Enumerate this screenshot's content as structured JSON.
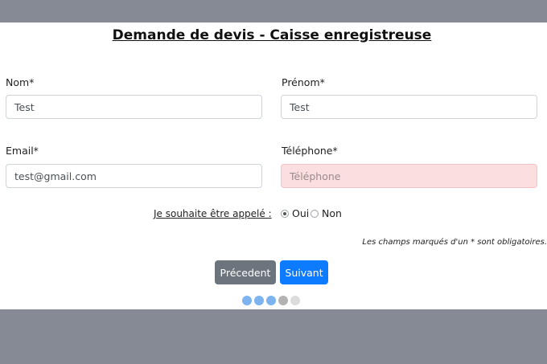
{
  "form": {
    "title": "Demande de devis - Caisse enregistreuse",
    "fields": {
      "nom": {
        "label": "Nom*",
        "value": "Test",
        "placeholder": ""
      },
      "prenom": {
        "label": "Prénom*",
        "value": "Test",
        "placeholder": ""
      },
      "email": {
        "label": "Email*",
        "value": "test@gmail.com",
        "placeholder": ""
      },
      "telephone": {
        "label": "Téléphone*",
        "value": "",
        "placeholder": "Téléphone",
        "state": "invalid"
      }
    },
    "call_preference": {
      "label": "Je souhaite être appelé :",
      "options": [
        {
          "label": "Oui",
          "checked": true
        },
        {
          "label": "Non",
          "checked": false
        }
      ]
    },
    "required_note": "Les champs marqués d'un * sont obligatoires.",
    "buttons": {
      "previous": "Précedent",
      "next": "Suivant"
    },
    "progress": {
      "total_steps": 5,
      "current_step": 4,
      "colors": {
        "done": "#7db4f0",
        "current": "#b3b3b3",
        "pending": "#dcdcdc"
      }
    }
  },
  "colors": {
    "backdrop": "#858a94",
    "primary": "#0d7bff",
    "secondary": "#6c757d",
    "invalid_bg": "#fbdfe0"
  }
}
